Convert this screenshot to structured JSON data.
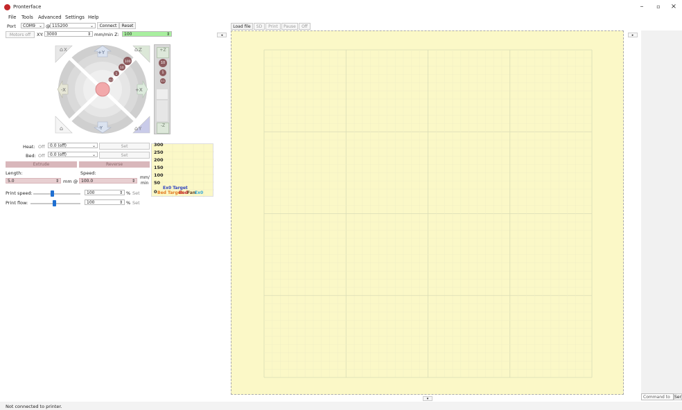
{
  "window": {
    "title": "Pronterface",
    "controls": [
      "–",
      "▫",
      "×"
    ]
  },
  "menu": [
    "File",
    "Tools",
    "Advanced",
    "Settings",
    "Help"
  ],
  "connection": {
    "port_label": "Port",
    "port_value": "COM9",
    "at_label": "@",
    "baud_value": "115200",
    "connect_label": "Connect",
    "reset_label": "Reset"
  },
  "movement": {
    "motors_off_label": "Motors off",
    "xy_label": "XY:",
    "xy_value": "3000",
    "unit_label": "mm/min Z:",
    "z_value": "100"
  },
  "jog": {
    "home_x": "X",
    "home_z": "Z",
    "home_y": "Y",
    "plus_y": "+Y",
    "minus_y": "-Y",
    "plus_x": "+X",
    "minus_x": "-X",
    "steps": [
      "100",
      "10",
      "1",
      "0.1"
    ],
    "plus_z": "+Z",
    "minus_z": "-Z",
    "z_steps": [
      "10",
      "1",
      "0.1"
    ]
  },
  "heating": {
    "heat_label": "Heat:",
    "heat_off": "Off",
    "heat_value": "0.0 (off)",
    "heat_set": "Set",
    "bed_label": "Bed:",
    "bed_off": "Off",
    "bed_value": "0.0 (off)",
    "bed_set": "Set"
  },
  "extrusion": {
    "extrude_label": "Extrude",
    "reverse_label": "Reverse",
    "length_label": "Length:",
    "speed_label": "Speed:",
    "length_value": "5.0",
    "mm_at_label": "mm @",
    "speed_value": "100.0",
    "speed_unit_top": "mm/",
    "speed_unit_bottom": "min"
  },
  "print_controls": {
    "speed_label": "Print speed:",
    "speed_value": "100",
    "speed_unit": "%",
    "speed_set": "Set",
    "speed_fraction": 0.4,
    "flow_label": "Print flow:",
    "flow_value": "100",
    "flow_unit": "%",
    "flow_set": "Set",
    "flow_fraction": 0.47
  },
  "temp_graph": {
    "ticks": [
      "300",
      "250",
      "200",
      "150",
      "100",
      "50",
      "0"
    ],
    "ex_target": "Ex0 Target",
    "bed_target": "Bed Target",
    "bed": "Bed",
    "fan": "Fan",
    "ex0": "Ex0"
  },
  "print_toolbar": [
    "Load file",
    "SD",
    "Print",
    "Pause",
    "Off"
  ],
  "collapse_left": "◂",
  "collapse_right": "▸",
  "collapse_bottom": "▾",
  "command": {
    "placeholder": "Command to",
    "send_label": "Sen"
  },
  "status": "Not connected to printer.",
  "colors": {
    "accent_red": "#c3272b",
    "plate": "#fbf8c7",
    "z_field": "#a8ef9f",
    "extrude_btn": "#d9b7bb",
    "slider": "#1f6fd1"
  }
}
